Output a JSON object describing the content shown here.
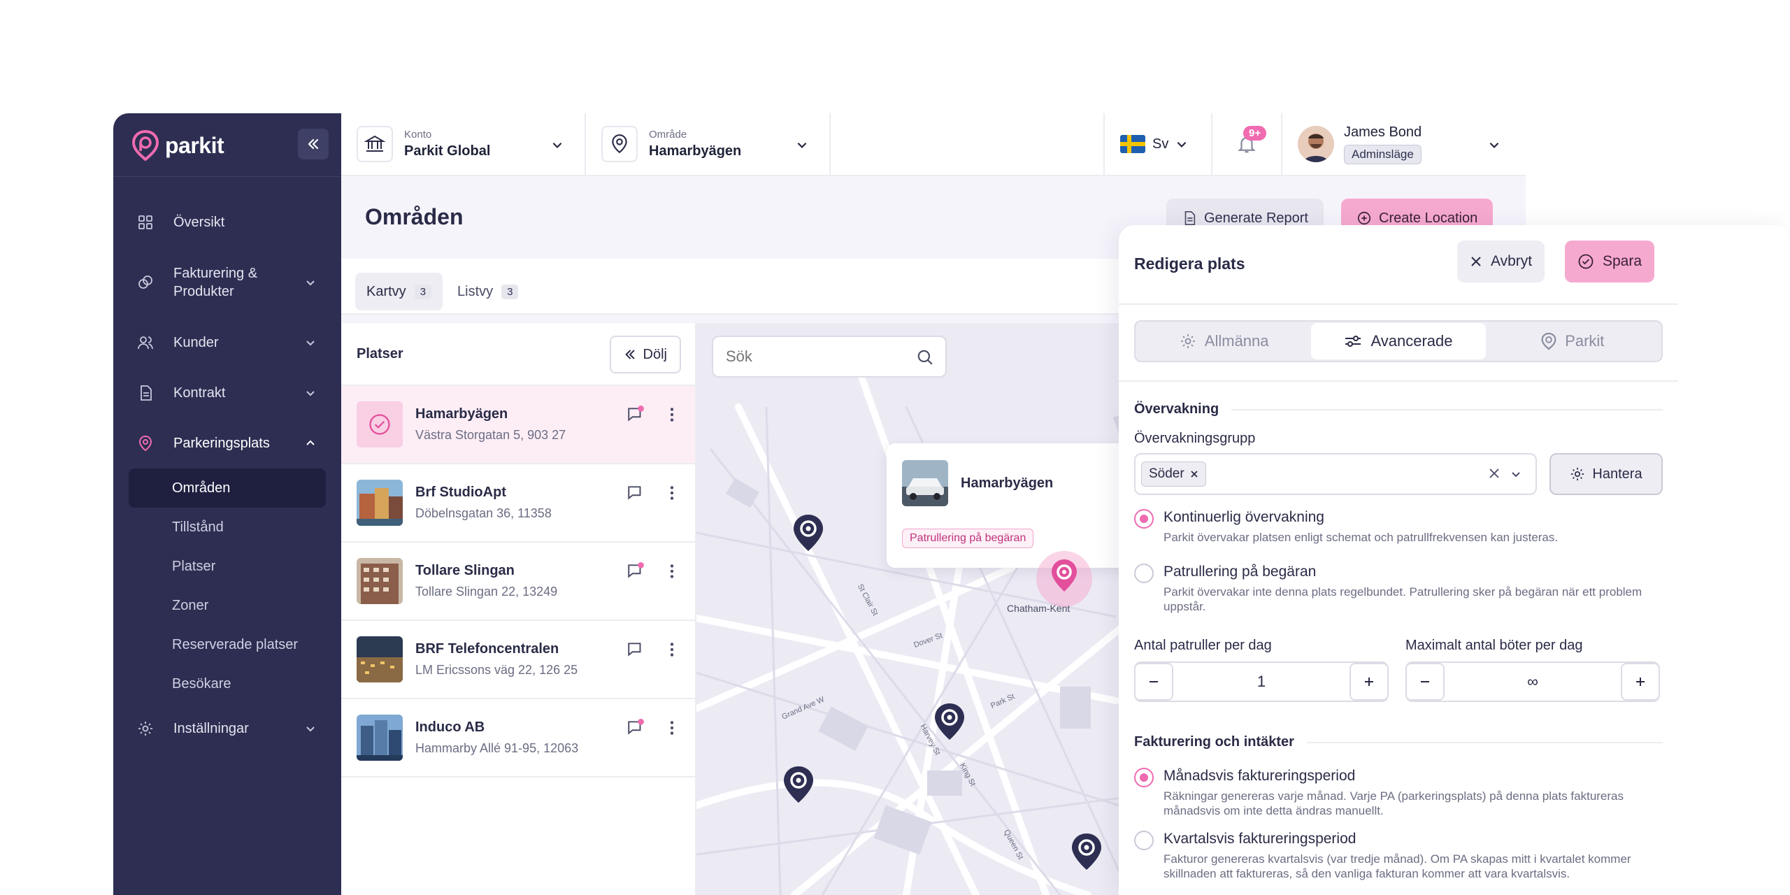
{
  "brand": {
    "name": "parkit",
    "accent": "#f06bb0",
    "sidebar_bg": "#2d2e52"
  },
  "sidebar": {
    "items": [
      {
        "label": "Översikt",
        "icon": "grid-icon"
      },
      {
        "label": "Fakturering & Produkter",
        "icon": "coins-icon"
      },
      {
        "label": "Kunder",
        "icon": "users-icon"
      },
      {
        "label": "Kontrakt",
        "icon": "document-icon"
      },
      {
        "label": "Parkeringsplats",
        "icon": "location-pin-icon"
      },
      {
        "label": "Inställningar",
        "icon": "gear-icon"
      }
    ],
    "subitems": [
      "Områden",
      "Tillstånd",
      "Platser",
      "Zoner",
      "Reserverade platser",
      "Besökare"
    ]
  },
  "topbar": {
    "account_label": "Konto",
    "account_value": "Parkit Global",
    "area_label": "Område",
    "area_value": "Hamarbyägen",
    "language": "Sv",
    "notifications": "9+",
    "user_name": "James Bond",
    "user_role": "Adminsläge"
  },
  "page": {
    "title": "Områden",
    "report_button": "Generate Report",
    "create_button": "Create Location",
    "tabs": [
      {
        "label": "Kartvy",
        "count": "3"
      },
      {
        "label": "Listvy",
        "count": "3"
      }
    ]
  },
  "list": {
    "title": "Platser",
    "hide_button": "Dölj",
    "rows": [
      {
        "name": "Hamarbyägen",
        "address": "Västra Storgatan 5, 903 27",
        "unread": true
      },
      {
        "name": "Brf StudioApt",
        "address": "Döbelnsgatan 36, 11358",
        "unread": false
      },
      {
        "name": "Tollare Slingan",
        "address": "Tollare Slingan 22, 13249",
        "unread": true
      },
      {
        "name": "BRF Telefoncentralen",
        "address": "LM Ericssons väg 22, 126 25",
        "unread": false
      },
      {
        "name": "Induco AB",
        "address": "Hammarby Allé 91-95, 12063",
        "unread": true
      }
    ]
  },
  "map": {
    "search_placeholder": "Sök",
    "popup_name": "Hamarbyägen",
    "popup_tag": "Patrullering på begäran",
    "labels": {
      "chatham": "Chatham-Kent",
      "grand_ave": "Grand Ave W",
      "park_st": "Park St",
      "st_clair": "St Clair St",
      "dover": "Dover St",
      "harvey": "Harvey St",
      "king": "King St",
      "queen": "Queen St"
    }
  },
  "drawer": {
    "title": "Redigera plats",
    "cancel": "Avbryt",
    "save": "Spara",
    "segments": [
      "Allmänna",
      "Avancerade",
      "Parkit"
    ],
    "active_segment": 1,
    "section_monitoring": "Övervakning",
    "group_label": "Övervakningsgrupp",
    "group_chip": "Söder",
    "manage": "Hantera",
    "radio_continuous": "Kontinuerlig övervakning",
    "radio_continuous_desc": "Parkit övervakar platsen enligt schemat och patrullfrekvensen kan justeras.",
    "radio_request": "Patrullering på begäran",
    "radio_request_desc": "Parkit övervakar inte denna plats regelbundet. Patrullering sker på begäran när ett problem uppstår.",
    "patrols_label": "Antal patruller per dag",
    "patrols_value": "1",
    "fines_label": "Maximalt antal böter per dag",
    "fines_value": "∞",
    "section_billing": "Fakturering och intäkter",
    "radio_monthly": "Månadsvis faktureringsperiod",
    "radio_monthly_desc": "Räkningar genereras varje månad. Varje PA (parkeringsplats) på denna plats faktureras månadsvis om inte detta ändras manuellt.",
    "radio_quarterly": "Kvartalsvis faktureringsperiod",
    "radio_quarterly_desc": "Fakturor genereras kvartalsvis (var tredje månad). Om PA skapas mitt i kvartalet kommer skillnaden att faktureras, så den vanliga fakturan kommer att vara kvartalsvis."
  }
}
